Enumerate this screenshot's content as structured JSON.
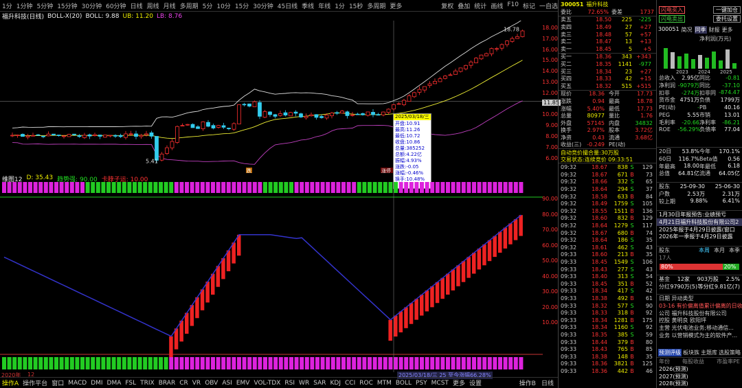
{
  "toolbar": {
    "items": [
      "1分",
      "1分钟",
      "5分钟",
      "15分钟",
      "30分钟",
      "60分钟",
      "日线",
      "周线",
      "月线",
      "多周期",
      "5分",
      "10分",
      "15分",
      "30分钟",
      "45日线",
      "季线",
      "年线",
      "1分",
      "15秒",
      "多周期",
      "更多"
    ],
    "right": [
      "复权",
      "叠加",
      "统计",
      "画线",
      "F10",
      "标记",
      "一自选"
    ]
  },
  "info": {
    "stock": "福升科技(日线)",
    "indicator": "BOLL-X(20)",
    "boll": "BOLL: 9.88",
    "ub": "UB: 11.20",
    "lb": "LB: 8.76"
  },
  "price_axis": [
    "18.00",
    "17.00",
    "16.00",
    "15.00",
    "14.00",
    "13.00",
    "12.00",
    "11.00",
    "10.00",
    "9.00",
    "8.00",
    "7.00",
    "6.00"
  ],
  "osc_axis": [
    "90.00",
    "80.00",
    "70.00",
    "60.00",
    "50.00",
    "40.00",
    "30.00",
    "20.00",
    "10.00"
  ],
  "high_label": "18.78",
  "low_label": "5.41",
  "current_price_tag": "11.85",
  "tooltip": {
    "date": "2025/03/18/三",
    "lines": [
      "开盘:10.91",
      "最高:11.26",
      "最低:10.72",
      "收盘:10.86",
      "总量:385252",
      "总额:4.22亿",
      "振幅:4.93%",
      "涨跌:-0.05",
      "涨幅:-0.46%",
      "换手:10.48%"
    ]
  },
  "sub_info": {
    "name": "维图12",
    "d": "D: 35.43",
    "a": "趋势强: 90.00",
    "b": "卡脖子运: 10.00"
  },
  "markers": [
    "跌",
    "涨停"
  ],
  "bottom_date": "2025/03/18/三 25 至今涨幅66.28%",
  "bottom_start": "2020年",
  "bottom_start2": "12",
  "bottombar": {
    "items": [
      "操作A",
      "操作平台",
      "窗口",
      "MACD",
      "DMI",
      "DMA",
      "FSL",
      "TRIX",
      "BRAR",
      "CR",
      "VR",
      "OBV",
      "ASI",
      "EMV",
      "VOL-TDX",
      "RSI",
      "WR",
      "SAR",
      "KDJ",
      "CCI",
      "ROC",
      "MTM",
      "BOLL",
      "PSY",
      "MCST",
      "更多",
      "设置"
    ],
    "right": [
      "操作B",
      "日线"
    ]
  },
  "quote": {
    "code": "300051",
    "name": "福升科技",
    "webi_label": "委比",
    "webi": "72.65%",
    "wecha_label": "委差",
    "wecha": "1737",
    "asks": [
      {
        "l": "卖五",
        "p": "18.50",
        "v": "225",
        "c": "-225"
      },
      {
        "l": "卖四",
        "p": "18.49",
        "v": "27",
        "c": "+27"
      },
      {
        "l": "卖三",
        "p": "18.48",
        "v": "57",
        "c": "+57"
      },
      {
        "l": "卖二",
        "p": "18.47",
        "v": "13",
        "c": "+13"
      },
      {
        "l": "卖一",
        "p": "18.45",
        "v": "5",
        "c": "+5"
      }
    ],
    "bids": [
      {
        "l": "买一",
        "p": "18.36",
        "v": "343",
        "c": "+343"
      },
      {
        "l": "买二",
        "p": "18.35",
        "v": "1141",
        "c": "-977"
      },
      {
        "l": "买三",
        "p": "18.34",
        "v": "23",
        "c": "+27"
      },
      {
        "l": "买四",
        "p": "18.33",
        "v": "42",
        "c": "+15"
      },
      {
        "l": "买五",
        "p": "18.32",
        "v": "515",
        "c": "+515"
      }
    ],
    "stats": [
      [
        "现价",
        "18.36",
        "今开",
        "17.73"
      ],
      [
        "涨跌",
        "0.94",
        "最高",
        "18.78"
      ],
      [
        "涨幅",
        "5.40%",
        "最低",
        "17.73"
      ],
      [
        "总量",
        "80977",
        "量比",
        "1.76"
      ],
      [
        "外盘",
        "57145",
        "内盘",
        "34832"
      ],
      [
        "换手",
        "2.97%",
        "股本",
        "3.72亿"
      ],
      [
        "净资",
        "0.43",
        "流通",
        "3.68亿"
      ],
      [
        "收益(三)",
        "-0.249",
        "PE(动)",
        ""
      ]
    ],
    "auction": "自动竞价撮合量:30万股",
    "auction2": "交易状态:连续竞价  09:33:51"
  },
  "ticks": [
    [
      "09:32",
      "18.67",
      "838",
      "S",
      "129"
    ],
    [
      "09:32",
      "18.67",
      "671",
      "B",
      "73"
    ],
    [
      "09:32",
      "18.66",
      "332",
      "S",
      "65"
    ],
    [
      "09:32",
      "18.64",
      "294",
      "S",
      "37"
    ],
    [
      "09:32",
      "18.58",
      "633",
      "B",
      "84"
    ],
    [
      "09:32",
      "18.49",
      "1759",
      "S",
      "105"
    ],
    [
      "09:32",
      "18.55",
      "1511",
      "B",
      "136"
    ],
    [
      "09:32",
      "18.60",
      "832",
      "B",
      "129"
    ],
    [
      "09:32",
      "18.64",
      "1279",
      "S",
      "117"
    ],
    [
      "09:32",
      "18.67",
      "680",
      "B",
      "74"
    ],
    [
      "09:32",
      "18.64",
      "186",
      "S",
      "35"
    ],
    [
      "09:32",
      "18.61",
      "462",
      "S",
      "43"
    ],
    [
      "09:33",
      "18.60",
      "213",
      "B",
      "35"
    ],
    [
      "09:33",
      "18.45",
      "1549",
      "S",
      "106"
    ],
    [
      "09:33",
      "18.43",
      "277",
      "S",
      "43"
    ],
    [
      "09:33",
      "18.40",
      "313",
      "S",
      "54"
    ],
    [
      "09:33",
      "18.45",
      "351",
      "B",
      "52"
    ],
    [
      "09:33",
      "18.34",
      "417",
      "S",
      "42"
    ],
    [
      "09:33",
      "18.38",
      "492",
      "B",
      "61"
    ],
    [
      "09:33",
      "18.32",
      "577",
      "S",
      "90"
    ],
    [
      "09:33",
      "18.33",
      "318",
      "B",
      "92"
    ],
    [
      "09:33",
      "18.34",
      "1281",
      "B",
      "175"
    ],
    [
      "09:33",
      "18.34",
      "1160",
      "S",
      "92"
    ],
    [
      "09:33",
      "18.35",
      "385",
      "S",
      "59"
    ],
    [
      "09:33",
      "18.44",
      "379",
      "B",
      "80"
    ],
    [
      "09:33",
      "18.43",
      "765",
      "B",
      "85"
    ],
    [
      "09:33",
      "18.38",
      "148",
      "B",
      "35"
    ],
    [
      "09:33",
      "18.36",
      "3821",
      "B",
      "125"
    ],
    [
      "09:33",
      "18.36",
      "442",
      "B",
      "46"
    ]
  ],
  "right": {
    "btn1": "闪电买入",
    "btn2": "闪电卖出",
    "btn3": "一键加仓",
    "btn4": "委托设置",
    "code": "300051",
    "tabs": [
      "简况",
      "同季",
      "财报",
      "更多"
    ],
    "chart_title": "净利润(万元)",
    "years": [
      "2023",
      "2024",
      "2025"
    ],
    "fin": [
      [
        "总收入",
        "2.95亿",
        "同比",
        "-0.81"
      ],
      [
        "净利润",
        "-9079万",
        "同比",
        "-37.10"
      ],
      [
        "扣非",
        "-274万",
        "扣非同",
        "-874.47"
      ],
      [
        "货币金",
        "4751万",
        "负债",
        "1799万"
      ],
      [
        "PE(动)",
        "-",
        "PB",
        "40.16"
      ],
      [
        "PEG",
        "5.55",
        "市销",
        "13.01"
      ],
      [
        "毛利率",
        "-20.66",
        "净利率",
        "-86.21"
      ],
      [
        "ROE",
        "-56.29%",
        "负债率",
        "77.04"
      ]
    ],
    "perf": [
      [
        "20日",
        "53.8%",
        "今年",
        "170.1%"
      ],
      [
        "60日",
        "116.7%",
        "Beta值",
        "0.56"
      ],
      [
        "年最高",
        "18.00",
        "年最低",
        "6.18"
      ],
      [
        "总值",
        "64.81亿",
        "流通",
        "64.05亿"
      ]
    ],
    "holders": [
      [
        "股东",
        "25-09-30",
        "25-06-30"
      ],
      [
        "户数",
        "2.53万",
        "2.31万"
      ],
      [
        "较上期",
        "9.88%",
        "6.41%"
      ]
    ],
    "news": [
      "1月30日年报预告:业绩预亏",
      "4月21日福升科技股份有限公司2",
      "2025年报于4月29日披露(窗口",
      "2026年一季报于4月29日披露"
    ],
    "vote": {
      "title": "股东",
      "people": "17人",
      "tabs": [
        "本周",
        "本月",
        "本季"
      ],
      "up": "80%",
      "down": "20%"
    },
    "extra": [
      [
        "基金",
        "12家",
        "903万股",
        "2.5%"
      ],
      [
        "分红",
        "9790万(5)",
        "等分红",
        "9.81亿(7)"
      ]
    ],
    "notes": [
      "日期    异动类型",
      "03-16   有价偏离值累计偏离的日收",
      "公司    福升科技股份有限公司",
      "控股    黄明良 欧阳坪",
      "主营    光伏电池业务;移动通信...",
      "业务    以营销模式为主的软件产..."
    ],
    "tabs2": [
      "预测评级",
      "板块族",
      "主题库",
      "选股策略"
    ],
    "forecast_head": [
      "年份",
      "每股收益",
      "市盈率PE"
    ],
    "forecast": [
      "2026(预测)",
      "2027(预测)",
      "2028(预测)"
    ]
  },
  "colors": {
    "up": "#ff3030",
    "down": "#33ccee",
    "mid": "#eeeeee",
    "upper": "#dddddd",
    "lower": "#c040c0"
  }
}
